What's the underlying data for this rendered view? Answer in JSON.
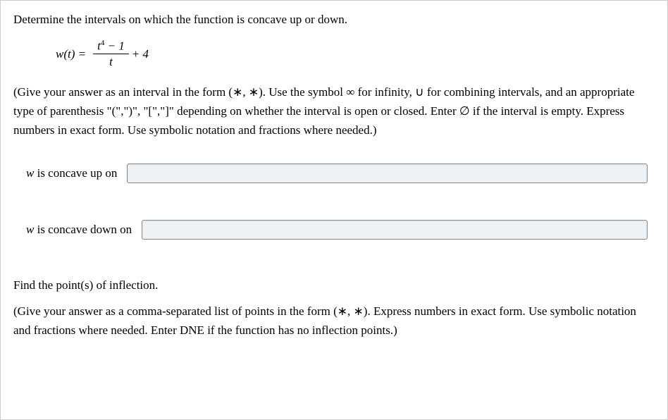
{
  "prompt": "Determine the intervals on which the function is concave up or down.",
  "formula": {
    "func": "w(t) =",
    "numerator": "t",
    "numerator_sup": "4",
    "numerator_tail": " − 1",
    "denominator": "t",
    "tail": "+ 4"
  },
  "instructions": "(Give your answer as an interval in the form (∗, ∗). Use the symbol ∞ for infinity, ∪ for combining intervals, and an appropriate type of parenthesis \"(\",\")\", \"[\",\"]\" depending on whether the interval is open or closed. Enter ∅ if the interval is empty. Express numbers in exact form. Use symbolic notation and fractions where needed.)",
  "answers": {
    "concave_up_label_w": "w",
    "concave_up_label_rest": " is concave up on",
    "concave_up_value": "",
    "concave_down_label_w": "w",
    "concave_down_label_rest": " is concave down on",
    "concave_down_value": ""
  },
  "inflection_heading": "Find the point(s) of inflection.",
  "inflection_instructions": "(Give your answer as a comma-separated list of points in the form (∗, ∗). Express numbers in exact form. Use symbolic notation and fractions where needed. Enter DNE if the function has no inflection points.)"
}
